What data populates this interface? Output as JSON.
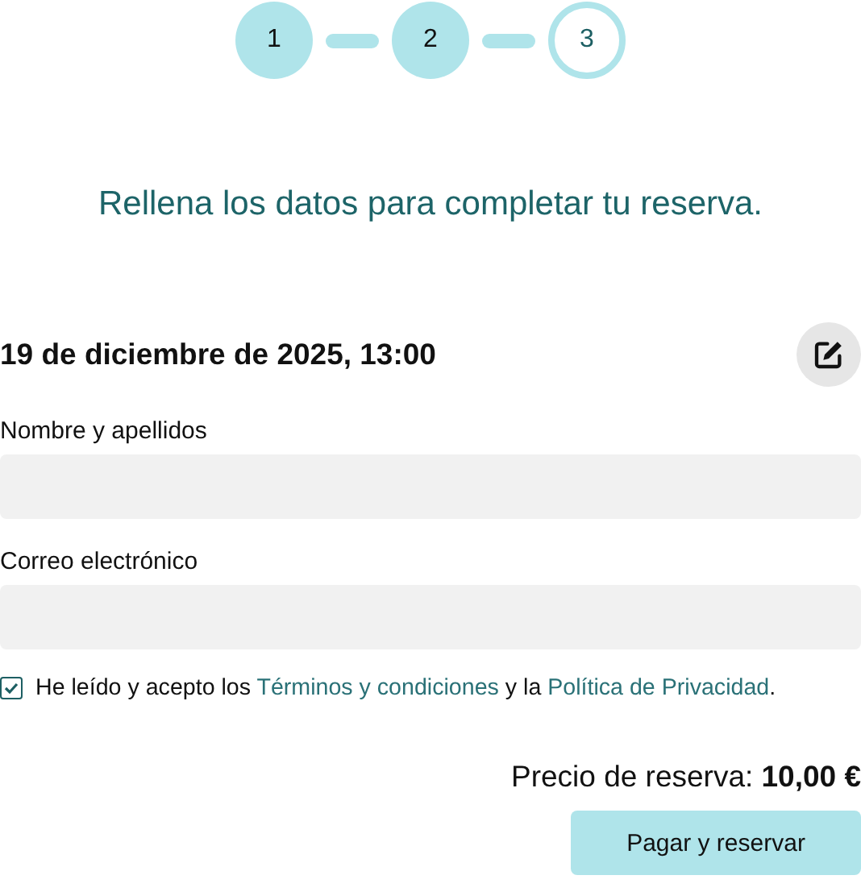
{
  "steps": [
    {
      "label": "1",
      "selected": false
    },
    {
      "label": "2",
      "selected": false
    },
    {
      "label": "3",
      "selected": true
    }
  ],
  "heading": "Rellena los datos para completar tu reserva.",
  "date": "19 de diciembre de 2025, 13:00",
  "fields": [
    {
      "label": "Nombre y apellidos"
    },
    {
      "label": "Correo electrónico"
    }
  ],
  "consent": {
    "checked": true,
    "parts": [
      {
        "kind": "text",
        "text": "He leído y acepto los "
      },
      {
        "kind": "link",
        "text": "Términos y condiciones"
      },
      {
        "kind": "text",
        "text": " y la "
      },
      {
        "kind": "link",
        "text": "Política de Privacidad"
      },
      {
        "kind": "text",
        "text": "."
      }
    ]
  },
  "price": "Precio de reserva: **10,00 €**",
  "submit": "Pagar y reservar"
}
